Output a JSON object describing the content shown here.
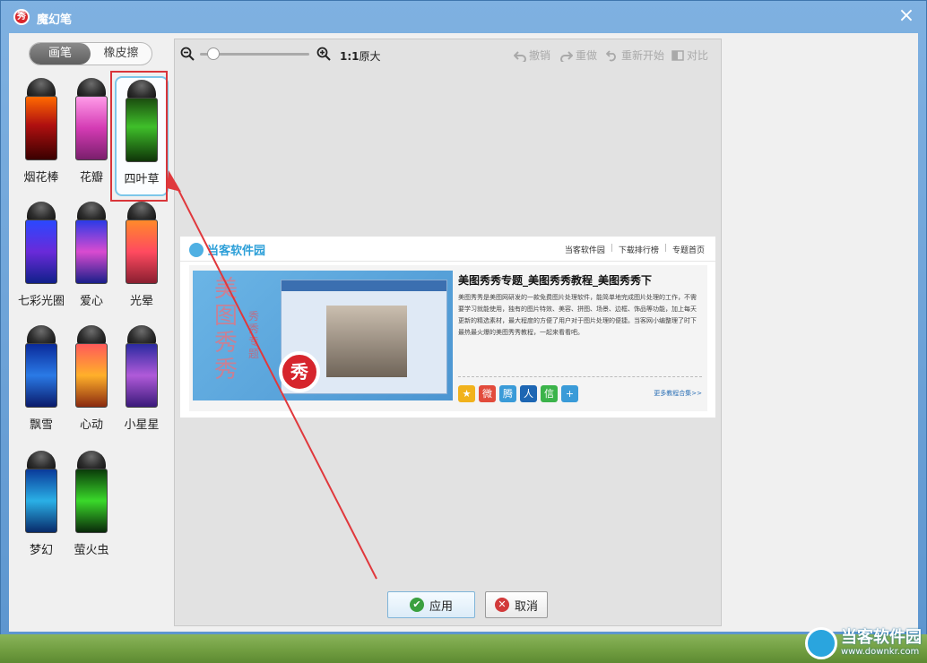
{
  "window": {
    "title": "魔幻笔",
    "app_icon": "秀",
    "close": "×"
  },
  "left_panel": {
    "tabs": [
      {
        "label": "画笔",
        "active": true
      },
      {
        "label": "橡皮擦",
        "active": false
      }
    ],
    "brushes": [
      {
        "label": "烟花棒",
        "selected": false,
        "gradient": "linear-gradient(180deg,#ff6a00,#b01010 45%,#3a0000 100%)"
      },
      {
        "label": "花瓣",
        "selected": false,
        "gradient": "linear-gradient(180deg,#ff9be8,#d43bb4 50%,#7a1f6c 100%)"
      },
      {
        "label": "四叶草",
        "selected": true,
        "gradient": "linear-gradient(180deg,#1b4d0f,#3fbf2a 45%,#0f3508 100%)"
      },
      {
        "label": "七彩光圈",
        "selected": false,
        "gradient": "linear-gradient(180deg,#2a48ff,#6a2ad9 50%,#10208a 100%)"
      },
      {
        "label": "爱心",
        "selected": false,
        "gradient": "linear-gradient(180deg,#2a3ae6,#d94bd0 50%,#1a1f8a 100%)"
      },
      {
        "label": "光晕",
        "selected": false,
        "gradient": "linear-gradient(180deg,#ff8a2a,#ff4a60 50%,#8a1f30 100%)"
      },
      {
        "label": "飘雪",
        "selected": false,
        "gradient": "linear-gradient(180deg,#0a2a9a,#2a7ae6 50%,#0a1a6a 100%)"
      },
      {
        "label": "心动",
        "selected": false,
        "gradient": "linear-gradient(180deg,#ff5a5a,#ffb02a 50%,#8a2a10 100%)"
      },
      {
        "label": "小星星",
        "selected": false,
        "gradient": "linear-gradient(180deg,#2a2aa0,#b05ad9 50%,#3a1a7a 100%)"
      },
      {
        "label": "梦幻",
        "selected": false,
        "gradient": "linear-gradient(180deg,#0a3a9a,#2ab0e6 50%,#082a6a 100%)"
      },
      {
        "label": "萤火虫",
        "selected": false,
        "gradient": "linear-gradient(180deg,#0a3a0a,#3ad92a 50%,#0a2a0a 100%)"
      }
    ]
  },
  "toolbar": {
    "ratio": "1:1",
    "original": "原大",
    "undo": "撤销",
    "redo": "重做",
    "restart": "重新开始",
    "compare": "对比"
  },
  "canvas": {
    "site_name": "当客软件园",
    "nav_links": [
      "当客软件园",
      "下载排行榜",
      "专题首页"
    ],
    "promo_vertical_text": "美图秀秀",
    "promo_sub_text": "秀秀专题",
    "promo_badge": "秀",
    "article_title": "美图秀秀专题_美图秀秀教程_美图秀秀下",
    "article_body": "美图秀秀是美图网研发的一款免费图片处理软件，能简单地完成图片处理的工作，不需要学习就能使用，独有的图片特效、美容、拼图、场景、边框、饰品等功能，加上每天更新的精选素材，最大程度的方便了用户对于图片处理的便捷。当客网小编整理了时下最热最火爆的美图秀秀教程，一起来看看吧。",
    "more_link": "更多教程合集>>",
    "share_icons": [
      {
        "name": "qzone-icon",
        "glyph": "★",
        "color": "#f1b21c"
      },
      {
        "name": "weibo-icon",
        "glyph": "微",
        "color": "#e24b3c"
      },
      {
        "name": "tencent-weibo-icon",
        "glyph": "腾",
        "color": "#3a9bd8"
      },
      {
        "name": "renren-icon",
        "glyph": "人",
        "color": "#1d66b3"
      },
      {
        "name": "wechat-icon",
        "glyph": "信",
        "color": "#3bb34a"
      },
      {
        "name": "more-share-icon",
        "glyph": "+",
        "color": "#3a9bd8"
      }
    ]
  },
  "buttons": {
    "apply": "应用",
    "cancel": "取消"
  },
  "watermark": {
    "title": "当客软件园",
    "url": "www.downkr.com"
  },
  "colors": {
    "title_bar": "#6a9fd6",
    "accent_red": "#d9363a",
    "selection": "#7cc7ea"
  }
}
